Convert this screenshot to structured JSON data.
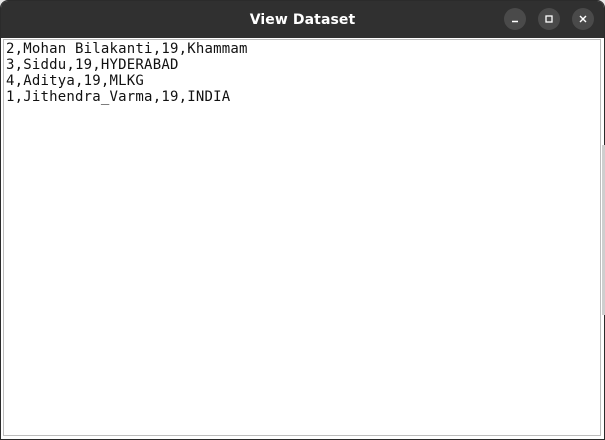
{
  "window": {
    "title": "View Dataset"
  },
  "controls": {
    "minimize": "minimize-icon",
    "maximize": "maximize-icon",
    "close": "close-icon"
  },
  "content": {
    "lines": [
      "2,Mohan Bilakanti,19,Khammam",
      "3,Siddu,19,HYDERABAD",
      "4,Aditya,19,MLKG",
      "1,Jithendra_Varma,19,INDIA"
    ]
  },
  "colors": {
    "titlebar": "#303030",
    "button": "#4a4a4a",
    "text": "#111111"
  }
}
